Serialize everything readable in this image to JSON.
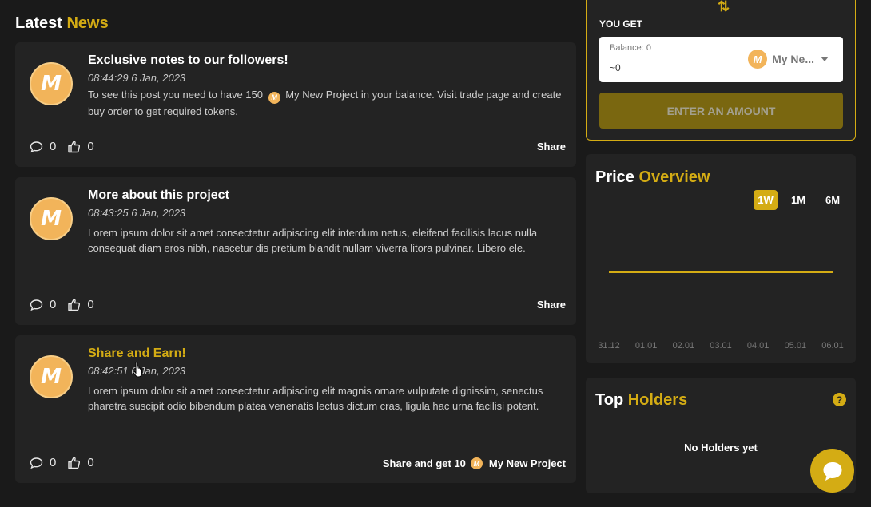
{
  "news": {
    "title_a": "Latest",
    "title_b": "News",
    "posts": [
      {
        "title": "Exclusive notes to our followers!",
        "date": "08:44:29 6 Jan, 2023",
        "body_a": "To see this post you need to have 150",
        "body_coin": "My New Project",
        "body_b": "in your balance. Visit trade page and create buy order to get required tokens.",
        "comments": "0",
        "likes": "0",
        "share": "Share"
      },
      {
        "title": "More about this project",
        "date": "08:43:25 6 Jan, 2023",
        "body": "Lorem ipsum dolor sit amet consectetur adipiscing elit interdum netus, eleifend facilisis lacus nulla consequat diam eros nibh, nascetur dis pretium blandit nullam viverra litora pulvinar. Libero ele.",
        "comments": "0",
        "likes": "0",
        "share": "Share"
      },
      {
        "title": "Share and Earn!",
        "date": "08:42:51 6 Jan, 2023",
        "body": "Lorem ipsum dolor sit amet consectetur adipiscing elit magnis ornare vulputate dignissim, senectus pharetra suscipit odio bibendum platea venenatis lectus dictum cras, ligula hac urna facilisi potent.",
        "comments": "0",
        "likes": "0",
        "share_a": "Share and get 10",
        "share_b": "My New Project"
      }
    ]
  },
  "swap": {
    "you_get": "YOU GET",
    "balance": "Balance: 0",
    "amount": "~0",
    "token": "My Ne...",
    "enter_button": "ENTER AN AMOUNT"
  },
  "price": {
    "title_a": "Price",
    "title_b": "Overview",
    "ranges": [
      "1W",
      "1M",
      "6M"
    ],
    "active_range": "1W",
    "chart_data": {
      "type": "line",
      "categories": [
        "31.12",
        "01.01",
        "02.01",
        "03.01",
        "04.01",
        "05.01",
        "06.01"
      ],
      "series": [
        {
          "values": [
            1,
            1,
            1,
            1,
            1,
            1,
            1
          ]
        }
      ],
      "ylim": [
        0,
        2
      ],
      "color": "#d4ac14"
    }
  },
  "holders": {
    "title_a": "Top",
    "title_b": "Holders",
    "help": "?",
    "empty": "No Holders yet"
  },
  "colors": {
    "accent": "#d4ac14",
    "coin": "#f2b45a",
    "panel": "#232323",
    "bg": "#1a1a1a"
  }
}
